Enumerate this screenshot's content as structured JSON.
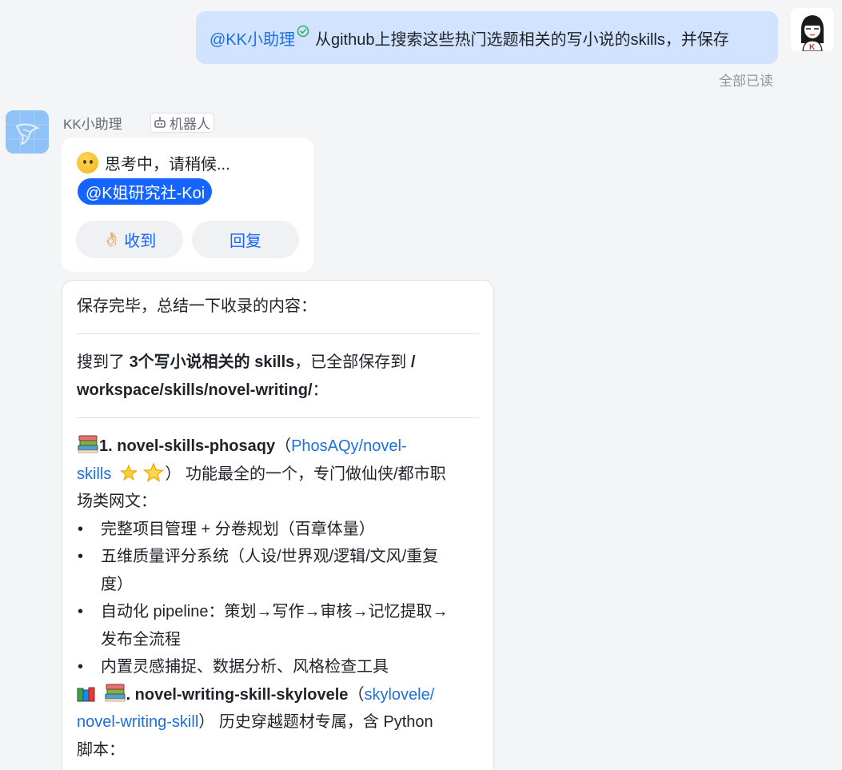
{
  "outgoing": {
    "mention": "@KK小助理",
    "text": "从github上搜索这些热门选题相关的写小说的skills，并保存",
    "read_status": "全部已读"
  },
  "bot": {
    "name": "KK小助理",
    "tag": "机器人"
  },
  "thinking_card": {
    "status": "思考中，请稍候...",
    "mention": "@K姐研究社-Koi",
    "ack_label": "收到",
    "reply_label": "回复"
  },
  "summary": {
    "intro": "保存完毕，总结一下收录的内容：",
    "saved_prefix": "搜到了 ",
    "saved_count": "3个写小说相关的 skills",
    "saved_mid": "，已全部保存到 ",
    "saved_path_1": "/",
    "saved_path_2": "workspace/skills/novel-writing/",
    "saved_suffix": "：",
    "skill1": {
      "title": "1. novel-skills-phosaqy",
      "open_paren": "（",
      "repo_a": "PhosAQy/novel-",
      "repo_b": "skills",
      "close_paren": "）",
      "desc_a": " 功能最全的一个，专门做仙侠/都市职",
      "desc_b": "场类网文：",
      "bullets": [
        "完整项目管理 + 分卷规划（百章体量）",
        "五维质量评分系统（人设/世界观/逻辑/文风/重复",
        "度）",
        "自动化 pipeline：策划→写作→审核→记忆提取→",
        "发布全流程",
        "内置灵感捕捉、数据分析、风格检查工具"
      ]
    },
    "skill2": {
      "title": ". novel-writing-skill-skylovele",
      "open_paren": "（",
      "repo_a": "skylovele/",
      "repo_b": "novel-writing-skill",
      "close_paren": "）",
      "desc_a": " 历史穿越题材专属，含 Python",
      "desc_b": "脚本："
    }
  },
  "colors": {
    "accent": "#1664ff",
    "link": "#1f6fe0",
    "outgoing_bubble": "#d1e3ff",
    "background": "#f4f5f7"
  }
}
